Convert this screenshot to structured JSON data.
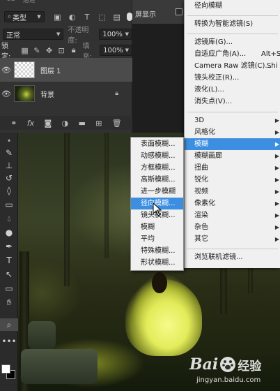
{
  "layers_panel": {
    "tab_labels": [
      "3D",
      "通道"
    ],
    "filter_kind": "类型",
    "blend_mode": "正常",
    "opacity_label": "不透明度:",
    "opacity_value": "100%",
    "lock_label": "锁定:",
    "fill_label": "填充:",
    "fill_value": "100%",
    "layers": [
      {
        "name": "图层 1",
        "selected": true
      },
      {
        "name": "背景",
        "selected": false,
        "locked": true
      }
    ]
  },
  "options_bar": {
    "text": "屏显示"
  },
  "filter_menu": {
    "items": [
      {
        "label": "径向模糊"
      },
      {
        "label": "转换为智能滤镜(S)"
      },
      {
        "label": "滤镜库(G)..."
      },
      {
        "label": "自适应广角(A)...",
        "shortcut": "Alt+Sh"
      },
      {
        "label": "Camera Raw 滤镜(C)...",
        "shortcut": "Shi"
      },
      {
        "label": "镜头校正(R)..."
      },
      {
        "label": "液化(L)..."
      },
      {
        "label": "消失点(V)..."
      },
      {
        "label": "3D"
      },
      {
        "label": "风格化"
      },
      {
        "label": "模糊",
        "highlighted": true
      },
      {
        "label": "模糊画廊"
      },
      {
        "label": "扭曲"
      },
      {
        "label": "锐化"
      },
      {
        "label": "视频"
      },
      {
        "label": "像素化"
      },
      {
        "label": "渲染"
      },
      {
        "label": "杂色"
      },
      {
        "label": "其它"
      },
      {
        "label": "浏览联机滤镜..."
      }
    ]
  },
  "blur_submenu": {
    "items": [
      {
        "label": "表面模糊..."
      },
      {
        "label": "动感模糊..."
      },
      {
        "label": "方框模糊..."
      },
      {
        "label": "高斯模糊..."
      },
      {
        "label": "进一步模糊"
      },
      {
        "label": "径向模糊...",
        "highlighted": true
      },
      {
        "label": "镜头模糊..."
      },
      {
        "label": "模糊"
      },
      {
        "label": "平均"
      },
      {
        "label": "特殊模糊..."
      },
      {
        "label": "形状模糊..."
      }
    ]
  },
  "watermark": {
    "brand": "Bai",
    "brand_cn": "经验",
    "url": "jingyan.baidu.com"
  },
  "colors": {
    "menu_highlight": "#3c8ee0",
    "menu_bg": "#f0f0f0",
    "panel_bg": "#323232"
  }
}
